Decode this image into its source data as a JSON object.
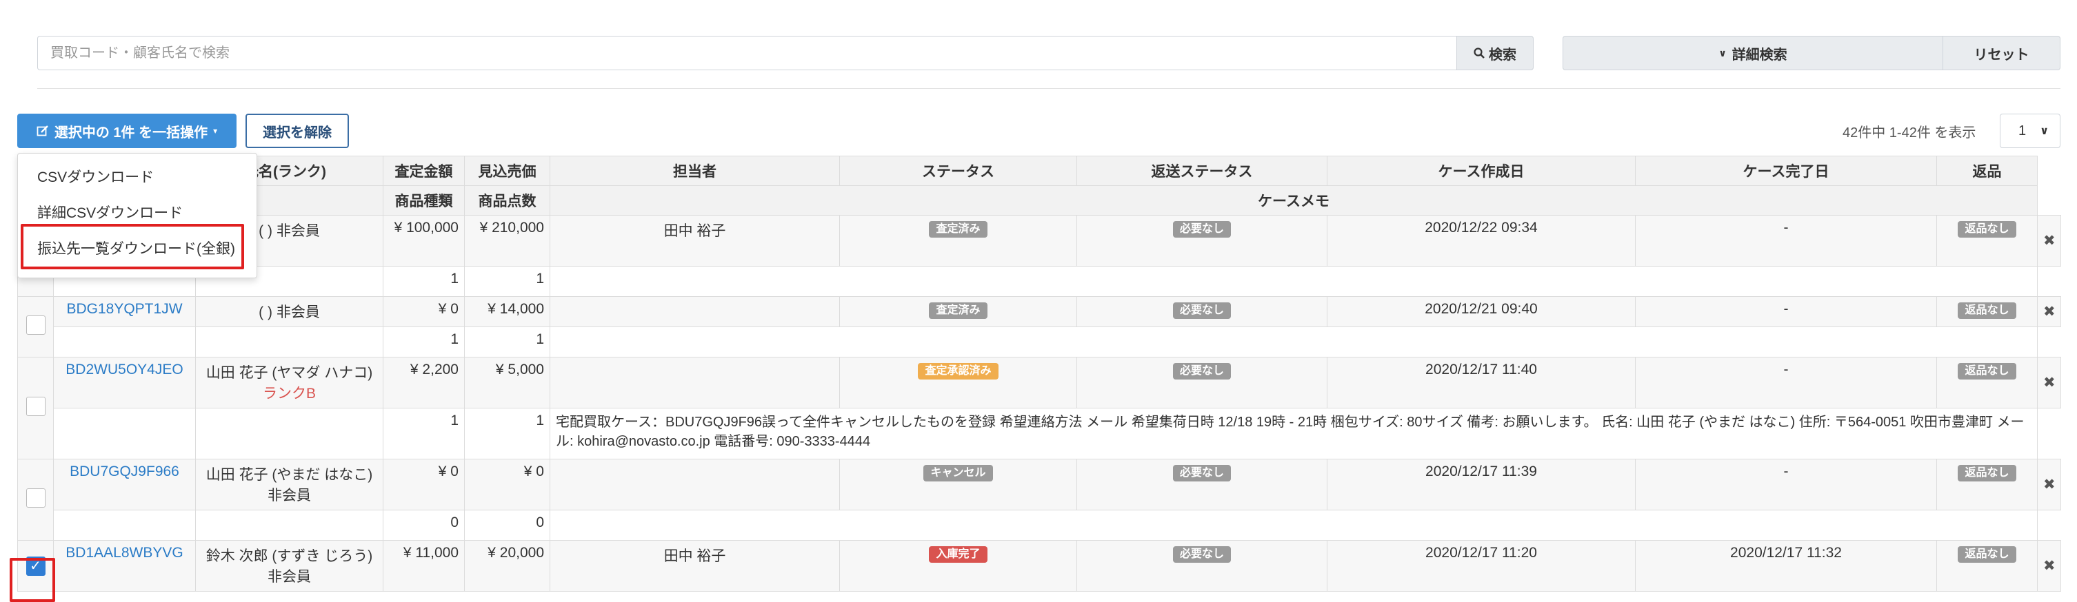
{
  "search": {
    "placeholder": "買取コード・顧客氏名で検索",
    "button_label": "検索",
    "detail_label": "詳細検索",
    "reset_label": "リセット"
  },
  "actions": {
    "bulk_label": "選択中の 1件 を一括操作",
    "clear_label": "選択を解除",
    "count_text": "42件中 1-42件 を表示",
    "page_value": "1"
  },
  "dropdown": {
    "items": [
      "CSVダウンロード",
      "詳細CSVダウンロード",
      "振込先一覧ダウンロード(全銀)"
    ]
  },
  "table": {
    "headers_row1": [
      "氏名(ランク)",
      "査定金額",
      "見込売価",
      "担当者",
      "ステータス",
      "返送ステータス",
      "ケース作成日",
      "ケース完了日",
      "返品"
    ],
    "headers_row2": [
      "商品種類",
      "商品点数",
      "ケースメモ"
    ],
    "rows": [
      {
        "code": "",
        "name": "( ) 非会員",
        "rank": "",
        "assess": "¥ 100,000",
        "expected": "¥ 210,000",
        "staff": "田中 裕子",
        "status": "査定済み",
        "return_status": "必要なし",
        "created": "2020/12/22 09:34",
        "completed": "-",
        "returned": "返品なし",
        "types": "1",
        "count": "1",
        "memo": ""
      },
      {
        "code": "BDG18YQPT1JW",
        "name": "( ) 非会員",
        "rank": "",
        "assess": "¥ 0",
        "expected": "¥ 14,000",
        "staff": "",
        "status": "査定済み",
        "return_status": "必要なし",
        "created": "2020/12/21 09:40",
        "completed": "-",
        "returned": "返品なし",
        "types": "1",
        "count": "1",
        "memo": ""
      },
      {
        "code": "BD2WU5OY4JEO",
        "name": "山田 花子 (ヤマダ ハナコ)",
        "rank": "ランクB",
        "assess": "¥ 2,200",
        "expected": "¥ 5,000",
        "staff": "",
        "status": "査定承認済み",
        "return_status": "必要なし",
        "created": "2020/12/17 11:40",
        "completed": "-",
        "returned": "返品なし",
        "types": "1",
        "count": "1",
        "memo": "宅配買取ケース：BDU7GQJ9F96誤って全件キャンセルしたものを登録 希望連絡方法 メール 希望集荷日時 12/18 19時 - 21時 梱包サイズ: 80サイズ 備考: お願いします。 氏名: 山田 花子 (やまだ はなこ) 住所: 〒564-0051 吹田市豊津町 メール: kohira@novasto.co.jp 電話番号: 090-3333-4444"
      },
      {
        "code": "BDU7GQJ9F966",
        "name": "山田 花子 (やまだ はなこ)",
        "rank": "非会員",
        "assess": "¥ 0",
        "expected": "¥ 0",
        "staff": "",
        "status": "キャンセル",
        "return_status": "必要なし",
        "created": "2020/12/17 11:39",
        "completed": "-",
        "returned": "返品なし",
        "types": "0",
        "count": "0",
        "memo": ""
      },
      {
        "code": "BD1AAL8WBYVG",
        "name": "鈴木 次郎 (すずき じろう)",
        "rank": "非会員",
        "assess": "¥ 11,000",
        "expected": "¥ 20,000",
        "staff": "田中 裕子",
        "status": "入庫完了",
        "return_status": "必要なし",
        "created": "2020/12/17 11:20",
        "completed": "2020/12/17 11:32",
        "returned": "返品なし",
        "types": "",
        "count": "",
        "memo": ""
      }
    ]
  },
  "colors": {
    "primary": "#3d8fd9",
    "link": "#2a7bc6",
    "highlight_border": "#e02020",
    "badge_gray": "#9a9a9a",
    "badge_yellow": "#f0ad4e",
    "badge_red": "#d9534f"
  }
}
